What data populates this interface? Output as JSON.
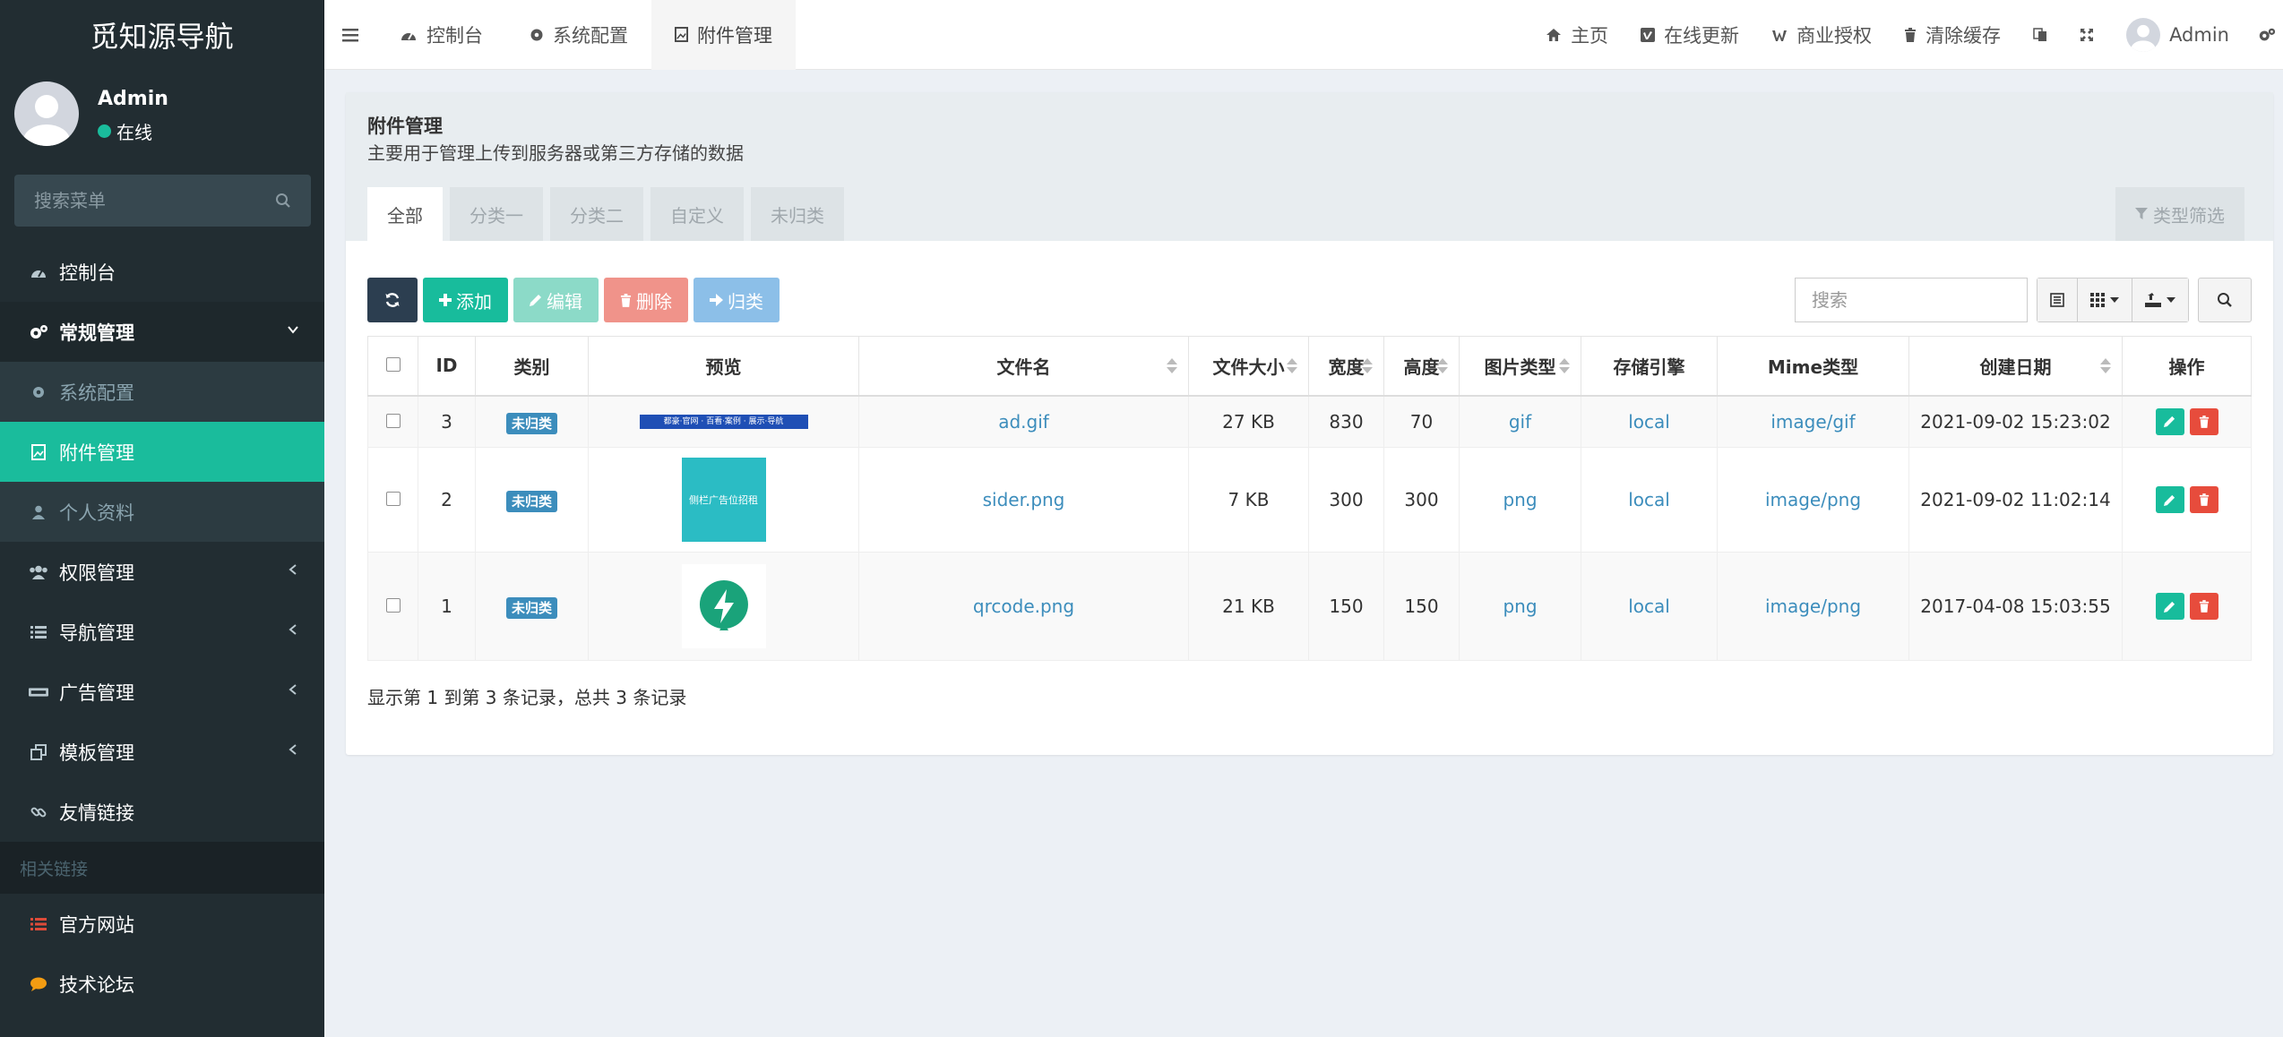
{
  "app": {
    "title": "觅知源导航"
  },
  "user": {
    "name": "Admin",
    "status": "在线"
  },
  "sidebar": {
    "search_placeholder": "搜索菜单",
    "items": [
      {
        "label": "控制台"
      },
      {
        "label": "常规管理"
      },
      {
        "label": "系统配置"
      },
      {
        "label": "附件管理"
      },
      {
        "label": "个人资料"
      },
      {
        "label": "权限管理"
      },
      {
        "label": "导航管理"
      },
      {
        "label": "广告管理"
      },
      {
        "label": "模板管理"
      },
      {
        "label": "友情链接"
      }
    ],
    "section_header": "相关链接",
    "links": [
      {
        "label": "官方网站"
      },
      {
        "label": "技术论坛"
      }
    ]
  },
  "topnav": {
    "tabs": [
      {
        "label": "控制台"
      },
      {
        "label": "系统配置"
      },
      {
        "label": "附件管理"
      }
    ],
    "right": [
      {
        "label": "主页"
      },
      {
        "label": "在线更新"
      },
      {
        "label": "商业授权"
      },
      {
        "label": "清除缓存"
      }
    ],
    "user_name": "Admin"
  },
  "panel": {
    "title": "附件管理",
    "description": "主要用于管理上传到服务器或第三方存储的数据",
    "tabs": [
      "全部",
      "分类一",
      "分类二",
      "自定义",
      "未归类"
    ],
    "type_filter": "类型筛选"
  },
  "toolbar": {
    "add": "添加",
    "edit": "编辑",
    "delete": "删除",
    "classify": "归类",
    "search_placeholder": "搜索"
  },
  "table": {
    "headers": [
      "ID",
      "类别",
      "预览",
      "文件名",
      "文件大小",
      "宽度",
      "高度",
      "图片类型",
      "存储引擎",
      "Mime类型",
      "创建日期",
      "操作"
    ],
    "rows": [
      {
        "id": "3",
        "category": "未归类",
        "preview_text": "都豪·官网 · 百看·案例 · 展示·导航",
        "filename": "ad.gif",
        "size": "27 KB",
        "width": "830",
        "height": "70",
        "imagetype": "gif",
        "storage": "local",
        "mime": "image/gif",
        "created": "2021-09-02 15:23:02"
      },
      {
        "id": "2",
        "category": "未归类",
        "preview_text": "侧栏广告位招租",
        "filename": "sider.png",
        "size": "7 KB",
        "width": "300",
        "height": "300",
        "imagetype": "png",
        "storage": "local",
        "mime": "image/png",
        "created": "2021-09-02 11:02:14"
      },
      {
        "id": "1",
        "category": "未归类",
        "preview_text": "",
        "filename": "qrcode.png",
        "size": "21 KB",
        "width": "150",
        "height": "150",
        "imagetype": "png",
        "storage": "local",
        "mime": "image/png",
        "created": "2017-04-08 15:03:55"
      }
    ]
  },
  "pagination": {
    "info": "显示第 1 到第 3 条记录，总共 3 条记录"
  },
  "colors": {
    "sidebar_bg": "#222d32",
    "accent": "#1abc9c",
    "link": "#3c8dbc",
    "danger": "#e74c3c"
  }
}
